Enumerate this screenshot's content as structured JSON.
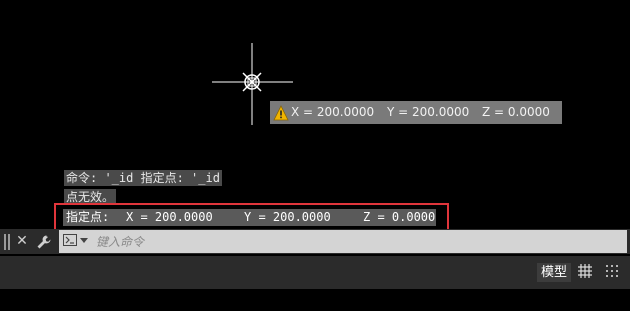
{
  "canvas": {
    "tooltip": {
      "x": "X = 200.0000",
      "y": "Y = 200.0000",
      "z": "Z = 0.0000",
      "icon": "warning-icon"
    }
  },
  "command_history": {
    "line1": "命令: '_id 指定点: '_id",
    "line2": "点无效。",
    "highlighted": {
      "prompt": "指定点:",
      "x": "X = 200.0000",
      "y": "Y = 200.0000",
      "z": "Z = 0.0000"
    }
  },
  "command_line": {
    "placeholder": "键入命令",
    "close_icon": "close-icon",
    "customize_icon": "wrench-icon"
  },
  "status_bar": {
    "model_label": "模型",
    "grid_icon": "grid-icon",
    "snap_icon": "snap-mode-icon"
  },
  "colors": {
    "highlight_border": "#e0353b",
    "warning": "#f0b400"
  }
}
